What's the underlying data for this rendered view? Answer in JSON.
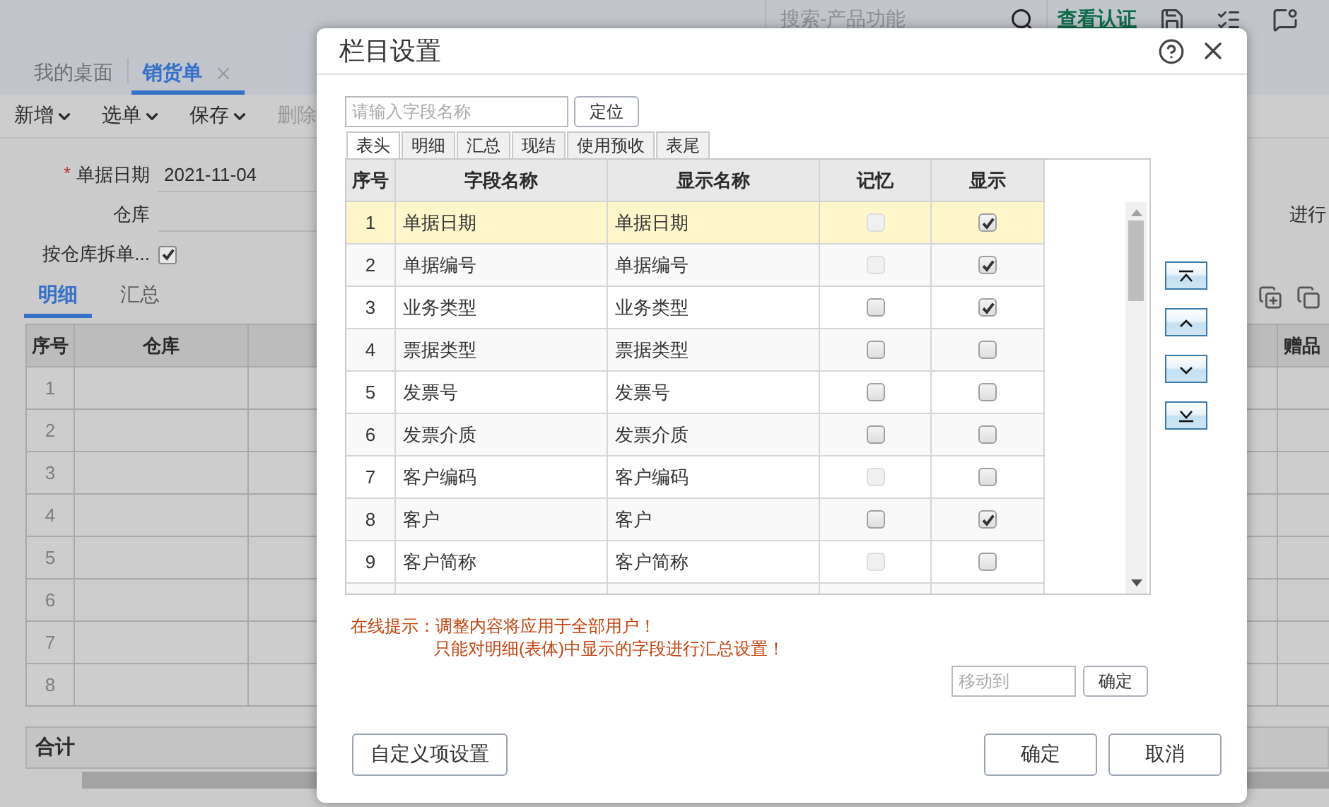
{
  "header": {
    "search": {
      "placeholder": "搜索-产品功能"
    },
    "link": "查看认证"
  },
  "page_tabs": [
    {
      "label": "我的桌面",
      "selected": false,
      "closable": false
    },
    {
      "label": "销货单",
      "selected": true,
      "closable": true
    }
  ],
  "toolbar": [
    {
      "label": "新增",
      "dropdown": true
    },
    {
      "label": "选单",
      "dropdown": true
    },
    {
      "label": "保存",
      "dropdown": true
    },
    {
      "label": "删除",
      "dropdown": false
    }
  ],
  "form": {
    "date": {
      "label": "单据日期",
      "required_mark": "*",
      "value": "2021-11-04"
    },
    "warehouse": {
      "label": "仓库"
    },
    "split": {
      "label": "按仓库拆单...",
      "checked": true
    },
    "right_label": "进行"
  },
  "detail_tabs": [
    {
      "label": "明细",
      "selected": true
    },
    {
      "label": "汇总",
      "selected": false
    }
  ],
  "grid": {
    "columns": [
      {
        "label": "序号",
        "kind": "index"
      },
      {
        "label": "仓库",
        "kind": "wide"
      },
      {
        "label": "赠品",
        "kind": "edge"
      }
    ],
    "row_numbers": [
      "1",
      "2",
      "3",
      "4",
      "5",
      "6",
      "7",
      "8"
    ],
    "total_label": "合计"
  },
  "dialog": {
    "title": "栏目设置",
    "search": {
      "placeholder": "请输入字段名称"
    },
    "locate_button": "定位",
    "tabs": [
      {
        "label": "表头",
        "selected": true
      },
      {
        "label": "明细",
        "selected": false
      },
      {
        "label": "汇总",
        "selected": false
      },
      {
        "label": "现结",
        "selected": false
      },
      {
        "label": "使用预收",
        "selected": false
      },
      {
        "label": "表尾",
        "selected": false
      }
    ],
    "columns": [
      "序号",
      "字段名称",
      "显示名称",
      "记忆",
      "显示"
    ],
    "rows": [
      {
        "index": "1",
        "field": "单据日期",
        "display": "单据日期",
        "remember": {
          "checked": false,
          "disabled": true
        },
        "show": true,
        "selected": true
      },
      {
        "index": "2",
        "field": "单据编号",
        "display": "单据编号",
        "remember": {
          "checked": false,
          "disabled": true
        },
        "show": true,
        "selected": false
      },
      {
        "index": "3",
        "field": "业务类型",
        "display": "业务类型",
        "remember": {
          "checked": false,
          "disabled": false
        },
        "show": true,
        "selected": false
      },
      {
        "index": "4",
        "field": "票据类型",
        "display": "票据类型",
        "remember": {
          "checked": false,
          "disabled": false
        },
        "show": false,
        "selected": false
      },
      {
        "index": "5",
        "field": "发票号",
        "display": "发票号",
        "remember": {
          "checked": false,
          "disabled": false
        },
        "show": false,
        "selected": false
      },
      {
        "index": "6",
        "field": "发票介质",
        "display": "发票介质",
        "remember": {
          "checked": false,
          "disabled": false
        },
        "show": false,
        "selected": false
      },
      {
        "index": "7",
        "field": "客户编码",
        "display": "客户编码",
        "remember": {
          "checked": false,
          "disabled": true
        },
        "show": false,
        "selected": false
      },
      {
        "index": "8",
        "field": "客户",
        "display": "客户",
        "remember": {
          "checked": false,
          "disabled": false
        },
        "show": true,
        "selected": false
      },
      {
        "index": "9",
        "field": "客户简称",
        "display": "客户简称",
        "remember": {
          "checked": false,
          "disabled": true
        },
        "show": false,
        "selected": false
      }
    ],
    "move_buttons": [
      {
        "kind": "top"
      },
      {
        "kind": "up"
      },
      {
        "kind": "down"
      },
      {
        "kind": "bottom"
      }
    ],
    "hints": [
      "在线提示：调整内容将应用于全部用户！",
      "只能对明细(表体)中显示的字段进行汇总设置！"
    ],
    "move_to": {
      "placeholder": "移动到",
      "button": "确定"
    },
    "custom_button": "自定义项设置",
    "ok_button": "确定",
    "cancel_button": "取消"
  }
}
